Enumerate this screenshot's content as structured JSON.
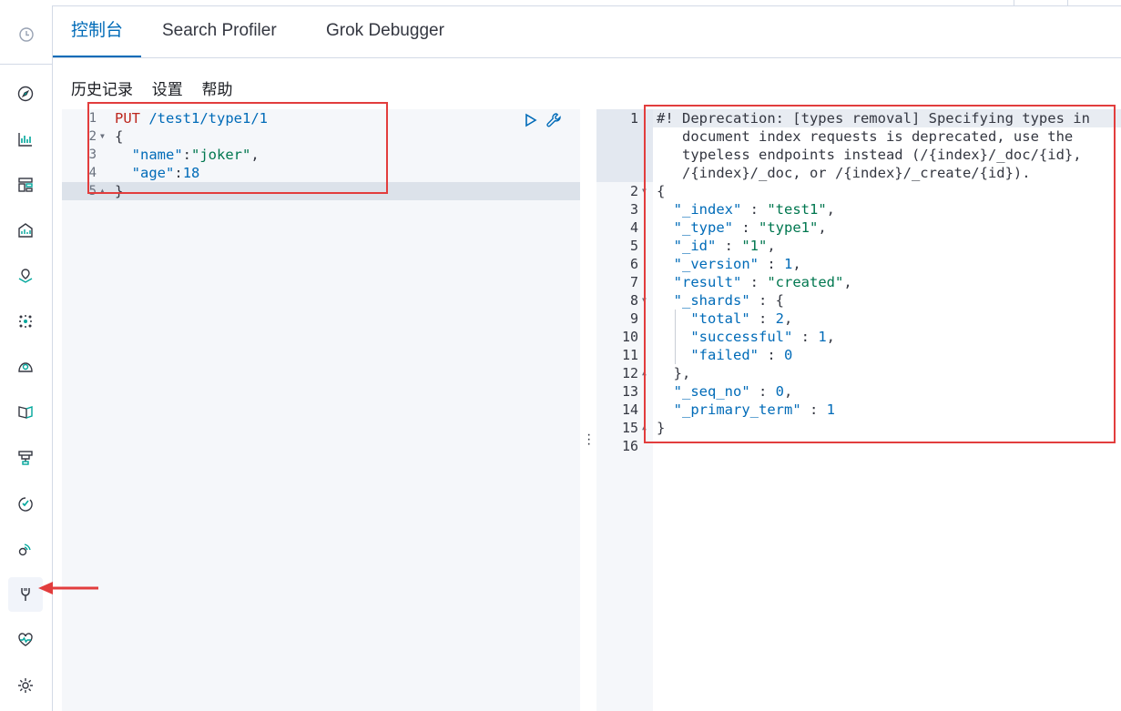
{
  "tabs": [
    {
      "label": "控制台",
      "active": true
    },
    {
      "label": "Search Profiler",
      "active": false
    },
    {
      "label": "Grok Debugger",
      "active": false
    }
  ],
  "submenu": [
    "历史记录",
    "设置",
    "帮助"
  ],
  "left_nav_icons": [
    "clock-icon",
    "compass-icon",
    "visualize-icon",
    "dashboard-icon",
    "canvas-icon",
    "maps-icon",
    "ml-icon",
    "graph-icon",
    "logs-icon",
    "infra-icon",
    "uptime-icon",
    "apm-icon",
    "dev-tools-icon",
    "monitoring-icon",
    "management-icon"
  ],
  "request": {
    "line_numbers": [
      "1",
      "2",
      "3",
      "4",
      "5"
    ],
    "method": "PUT",
    "url": "/test1/type1/1",
    "open_brace": "{",
    "close_brace": "}",
    "fields": [
      {
        "key": "\"name\"",
        "sep": ":",
        "value": "\"joker\"",
        "value_type": "string",
        "trail": ","
      },
      {
        "key": "\"age\"",
        "sep": ":",
        "value": "18",
        "value_type": "number",
        "trail": ""
      }
    ]
  },
  "response": {
    "line_numbers": [
      "1",
      "2",
      "3",
      "4",
      "5",
      "6",
      "7",
      "8",
      "9",
      "10",
      "11",
      "12",
      "13",
      "14",
      "15",
      "16"
    ],
    "warning_lines": [
      "#! Deprecation: [types removal] Specifying types in",
      "   document index requests is deprecated, use the",
      "   typeless endpoints instead (/{index}/_doc/{id},",
      "   /{index}/_doc, or /{index}/_create/{id})."
    ],
    "open_brace": "{",
    "fields": [
      {
        "key": "\"_index\"",
        "value": "\"test1\"",
        "value_type": "string"
      },
      {
        "key": "\"_type\"",
        "value": "\"type1\"",
        "value_type": "string"
      },
      {
        "key": "\"_id\"",
        "value": "\"1\"",
        "value_type": "string"
      },
      {
        "key": "\"_version\"",
        "value": "1",
        "value_type": "number"
      },
      {
        "key": "\"result\"",
        "value": "\"created\"",
        "value_type": "string"
      }
    ],
    "shards_key": "\"_shards\"",
    "shards": [
      {
        "key": "\"total\"",
        "value": "2"
      },
      {
        "key": "\"successful\"",
        "value": "1"
      },
      {
        "key": "\"failed\"",
        "value": "0"
      }
    ],
    "shards_close": "},",
    "tail_fields": [
      {
        "key": "\"_seq_no\"",
        "value": "0"
      },
      {
        "key": "\"_primary_term\"",
        "value": "1"
      }
    ],
    "close_brace": "}"
  },
  "colors": {
    "accent": "#006bb8",
    "annotation_red": "#e23d3d",
    "string": "#00774f",
    "warning": "#bd271e"
  }
}
